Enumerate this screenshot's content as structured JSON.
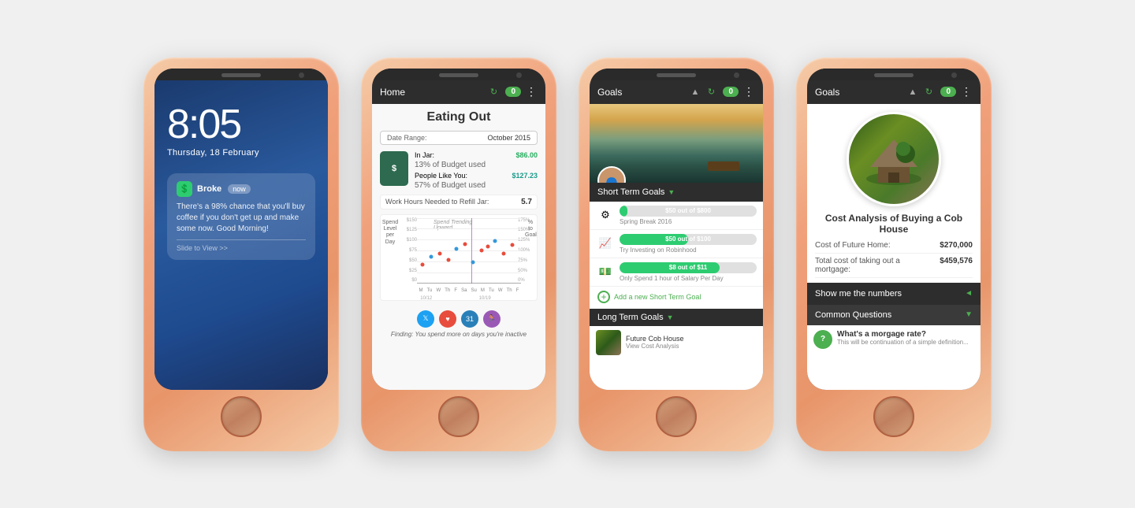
{
  "phone1": {
    "time": "8:05",
    "date": "Thursday, 18 February",
    "notification": {
      "app": "Broke",
      "time_badge": "now",
      "body": "There's a 98% chance that you'll buy coffee if you don't get up and make some now. Good Morning!",
      "slide": "Slide to View >>"
    }
  },
  "phone2": {
    "header": {
      "title": "Home",
      "badge": "0",
      "dots": "⋮"
    },
    "section_title": "Eating Out",
    "date_range_label": "Date Range:",
    "date_range_value": "October 2015",
    "in_jar_label": "In Jar:",
    "in_jar_amount": "$86.00",
    "in_jar_pct": "13% of Budget used",
    "people_like_you_label": "People Like You:",
    "people_like_you_amount": "$127.23",
    "people_like_you_pct": "57% of Budget used",
    "work_hours_label": "Work Hours Needed to Refill Jar:",
    "work_hours_value": "5.7",
    "chart_title": "Spend Trending Upward",
    "y_axis_label": "Spend\nLevel\nper\nDay",
    "finding": "Finding: You spend more on days you're inactive",
    "x_labels": [
      "M",
      "Tu",
      "W",
      "Th",
      "F",
      "Sa",
      "Su",
      "M",
      "Tu",
      "W",
      "Th",
      "F"
    ],
    "x_dates": [
      "10/12",
      "",
      "",
      "",
      "",
      "",
      "",
      "10/19",
      "",
      "",
      "",
      ""
    ],
    "pct_to_goal_label": "% to\nGoal"
  },
  "phone3": {
    "header": {
      "title": "Goals",
      "badge": "0"
    },
    "short_term_label": "Short Term Goals",
    "goals": [
      {
        "icon": "⚙",
        "label": "$50 out of $800",
        "subtitle": "Spring Break 2016",
        "fill_pct": 6
      },
      {
        "icon": "📊",
        "label": "$50 out of $100",
        "subtitle": "Try Investing on Robinhood",
        "fill_pct": 50
      },
      {
        "icon": "💵",
        "label": "$8 out of $11",
        "subtitle": "Only Spend 1 hour of Salary Per Day",
        "fill_pct": 73
      }
    ],
    "add_goal_label": "Add a new Short Term Goal",
    "long_term_label": "Long Term Goals",
    "long_term_item": {
      "name": "Future Cob House",
      "sub": "View Cost Analysis"
    }
  },
  "phone4": {
    "header": {
      "title": "Goals",
      "badge": "0"
    },
    "cost_title": "Cost Analysis of Buying a Cob House",
    "cost_rows": [
      {
        "label": "Cost of Future Home:",
        "value": "$270,000"
      },
      {
        "label": "Total cost of taking out a mortgage:",
        "value": "$459,576"
      }
    ],
    "show_numbers_label": "Show me the numbers",
    "common_q_label": "Common Questions",
    "question": {
      "title": "What's a morgage rate?",
      "sub": "This will be continuation of a simple definition..."
    }
  }
}
